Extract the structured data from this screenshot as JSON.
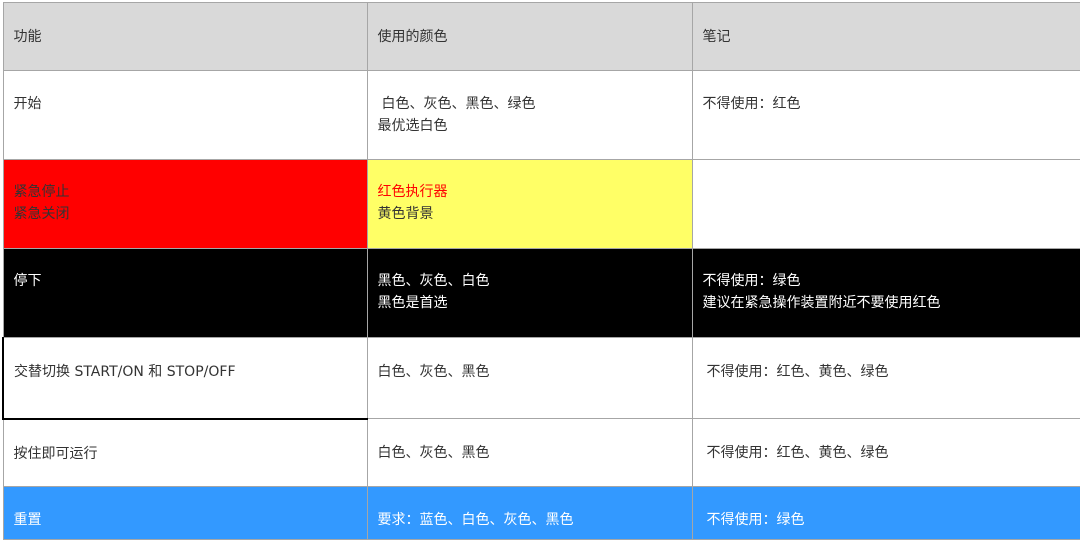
{
  "header": {
    "function": "功能",
    "colors": "使用的颜色",
    "notes": "笔记"
  },
  "rows": [
    {
      "function": [
        "开始"
      ],
      "colors": [
        "白色、灰色、黑色、绿色",
        "最优选白色"
      ],
      "notes": [
        "不得使用：红色"
      ]
    },
    {
      "function": [
        "紧急停止",
        "紧急关闭"
      ],
      "colors": [
        "红色执行器",
        "黄色背景"
      ],
      "notes": []
    },
    {
      "function": [
        "停下"
      ],
      "colors": [
        "黑色、灰色、白色",
        "黑色是首选"
      ],
      "notes": [
        "不得使用：绿色",
        "建议在紧急操作装置附近不要使用红色"
      ]
    },
    {
      "function": [
        "交替切换 START/ON 和 STOP/OFF"
      ],
      "colors": [
        "白色、灰色、黑色"
      ],
      "notes": [
        "不得使用：红色、黄色、绿色"
      ]
    },
    {
      "function": [
        "按住即可运行"
      ],
      "colors": [
        "白色、灰色、黑色"
      ],
      "notes": [
        "不得使用：红色、黄色、绿色"
      ]
    },
    {
      "function": [
        "重置"
      ],
      "colors": [
        "要求：蓝色、白色、灰色、黑色"
      ],
      "notes": [
        "不得使用：绿色"
      ]
    }
  ],
  "row_colors": {
    "emergency": "#ff0000",
    "emergency_colors_cell": "#ffff66",
    "stop": "#000000",
    "reset": "#3399ff",
    "header": "#d9d9d9"
  }
}
